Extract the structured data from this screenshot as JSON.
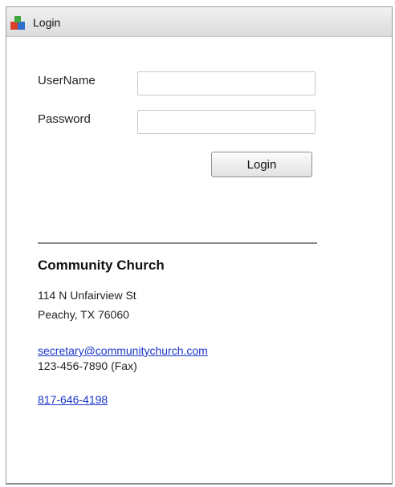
{
  "window": {
    "title": "Login"
  },
  "form": {
    "username_label": "UserName",
    "username_value": "",
    "password_label": "Password",
    "password_value": "",
    "login_button_label": "Login"
  },
  "contact": {
    "org_name": "Community Church",
    "address_line1": "114 N Unfairview St",
    "address_line2": "Peachy, TX 76060",
    "email": "secretary@communitychurch.com",
    "fax": "123-456-7890  (Fax)",
    "phone": "817-646-4198"
  },
  "colors": {
    "link": "#1a35c9",
    "divider": "#8a8a8a",
    "icon_red": "#d9412b",
    "icon_green": "#3fa63b",
    "icon_blue": "#2f6fd1"
  },
  "icons": {
    "title_icon": "app-blocks-icon"
  }
}
